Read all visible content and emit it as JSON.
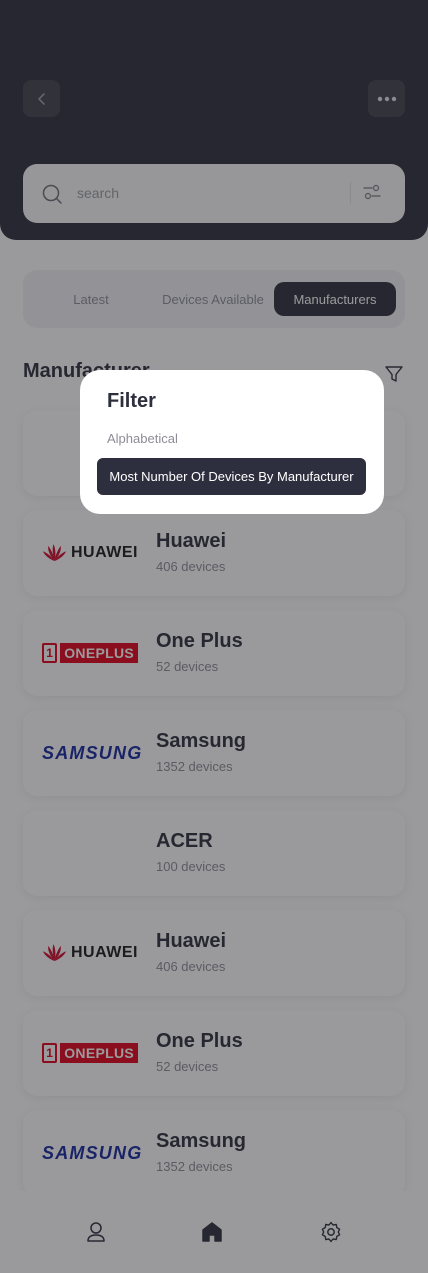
{
  "header": {
    "search_placeholder": "search"
  },
  "tabs": [
    "Latest",
    "Devices Available",
    "Manufacturers"
  ],
  "active_tab": "Manufacturers",
  "section": {
    "title": "Manufacturer"
  },
  "manufacturers": [
    {
      "logo": "huawei-logo",
      "logo_text": "HUAWEI",
      "name": "Huawei",
      "count": "406 devices"
    },
    {
      "logo": "oneplus-logo",
      "logo_text": "ONEPLUS",
      "name": "One Plus",
      "count": "52 devices"
    },
    {
      "logo": "samsung-logo",
      "logo_text": "SAMSUNG",
      "name": "Samsung",
      "count": "1352 devices"
    },
    {
      "logo": "acer-logo",
      "logo_text": "",
      "name": "ACER",
      "count": "100 devices"
    },
    {
      "logo": "huawei-logo",
      "logo_text": "HUAWEI",
      "name": "Huawei",
      "count": "406 devices"
    },
    {
      "logo": "oneplus-logo",
      "logo_text": "ONEPLUS",
      "name": "One Plus",
      "count": "52 devices"
    },
    {
      "logo": "samsung-logo",
      "logo_text": "SAMSUNG",
      "name": "Samsung",
      "count": "1352 devices"
    }
  ],
  "filter_popup": {
    "title": "Filter",
    "options": [
      "Alphabetical",
      "Most Number Of Devices By Manufacturer"
    ],
    "selected": "Most Number Of Devices By Manufacturer"
  },
  "bottom_nav": [
    "profile-icon",
    "home-icon",
    "settings-icon"
  ],
  "colors": {
    "primary_dark": "#2e2f3e",
    "oneplus_red": "#e2001a",
    "samsung_blue": "#1428a0",
    "huawei_red": "#cf0a2c"
  }
}
